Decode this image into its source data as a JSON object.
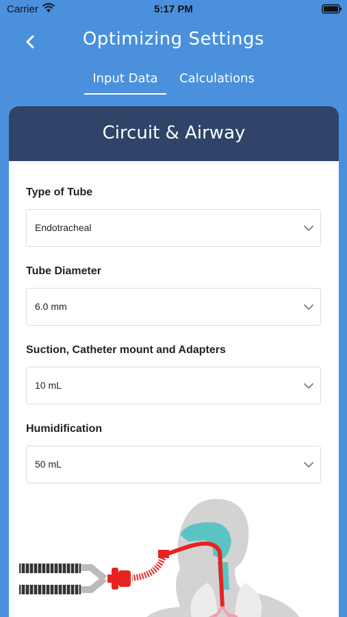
{
  "status_bar": {
    "carrier": "Carrier",
    "time": "5:17 PM"
  },
  "header": {
    "title": "Optimizing Settings"
  },
  "tabs": [
    {
      "label": "Input Data",
      "active": true
    },
    {
      "label": "Calculations",
      "active": false
    }
  ],
  "card": {
    "title": "Circuit & Airway",
    "fields": [
      {
        "label": "Type of Tube",
        "value": "Endotracheal"
      },
      {
        "label": "Tube Diameter",
        "value": "6.0 mm"
      },
      {
        "label": "Suction, Catheter mount and Adapters",
        "value": "10 mL"
      },
      {
        "label": "Humidification",
        "value": "50 mL"
      }
    ]
  },
  "colors": {
    "background": "#4a90dc",
    "card_header": "#2f4468",
    "tube": "#e8231f"
  },
  "icons": [
    "wifi-icon",
    "battery-icon",
    "chevron-left-icon",
    "chevron-down-icon"
  ]
}
